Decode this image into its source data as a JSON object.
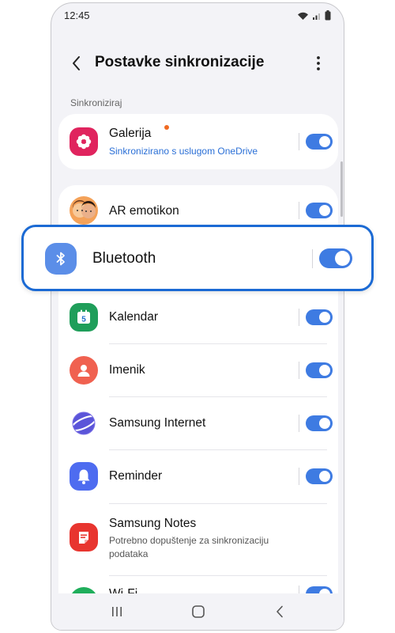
{
  "status_bar": {
    "time": "12:45"
  },
  "header": {
    "title": "Postavke sinkronizacije"
  },
  "section": {
    "label": "Sinkroniziraj"
  },
  "items": [
    {
      "title": "Galerija",
      "subtitle": "Sinkronizirano s uslugom OneDrive",
      "enabled": true,
      "icon": "gallery-icon"
    },
    {
      "title": "AR emotikon",
      "enabled": true,
      "icon": "ar-emoji-icon"
    },
    {
      "title": "Kalendar",
      "enabled": true,
      "icon": "calendar-icon",
      "icon_text": "5"
    },
    {
      "title": "Imenik",
      "enabled": true,
      "icon": "contacts-icon"
    },
    {
      "title": "Samsung Internet",
      "enabled": true,
      "icon": "internet-icon"
    },
    {
      "title": "Reminder",
      "enabled": true,
      "icon": "reminder-icon"
    },
    {
      "title": "Samsung Notes",
      "subtitle": "Potrebno dopuštenje za sinkronizaciju podataka",
      "icon": "notes-icon"
    },
    {
      "title": "Wi-Fi",
      "enabled": true,
      "icon": "wifi-icon"
    }
  ],
  "highlight": {
    "title": "Bluetooth",
    "enabled": true,
    "icon": "bluetooth-icon"
  },
  "colors": {
    "accent": "#3e7be2",
    "callout_border": "#1b6ad4",
    "badge": "#f06a22",
    "link": "#2a6fd6",
    "background": "#f3f3f7"
  }
}
